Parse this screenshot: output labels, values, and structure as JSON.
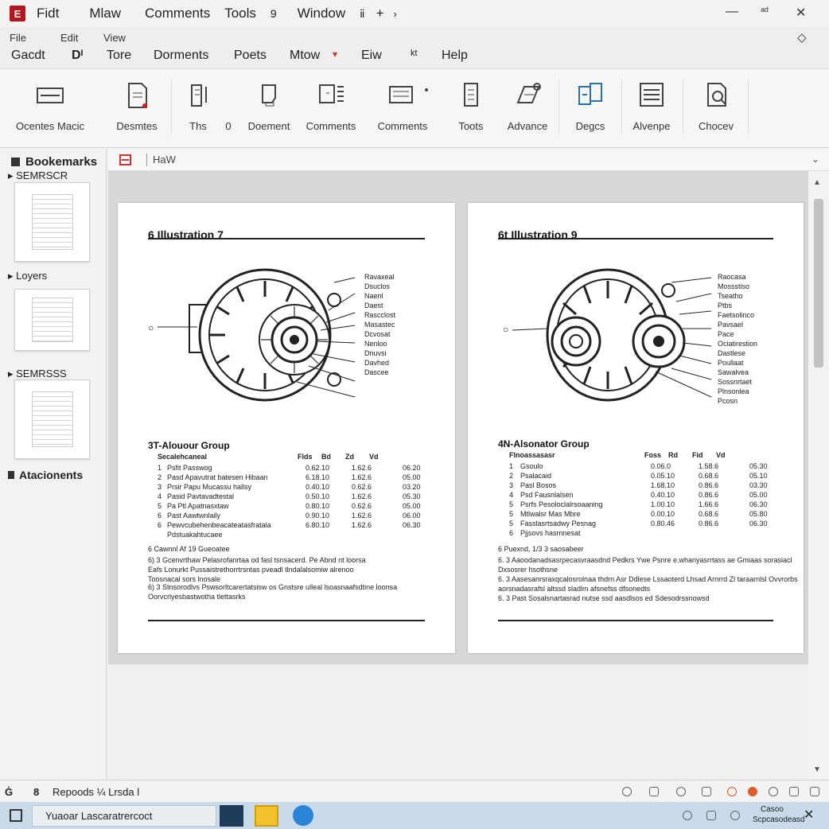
{
  "titlebar": {
    "app_icon_glyph": "E",
    "menus": [
      "Fidt",
      "Mlaw",
      "Comments",
      "Tools",
      "9",
      "Window",
      "ⅱ",
      "+",
      "›"
    ],
    "window_controls": [
      "—",
      "ᵃᵈ",
      "✕"
    ],
    "menubar2": [
      "File",
      "Edit",
      "View"
    ],
    "menubar2_right_icon": "◇",
    "menubar3": [
      "Gacdt",
      "Dᴵ",
      "Tore",
      "Dorments",
      "Poets",
      "Mtow",
      "▾",
      "Eiw",
      "ᵏᵗ",
      "Help"
    ]
  },
  "toolbar": {
    "tools": [
      {
        "label": "Ocentes Macic",
        "icon": "document-magic-icon"
      },
      {
        "label": "Desmtes",
        "icon": "document-edit-icon"
      },
      {
        "label": "Ths",
        "icon": "text-tool-icon"
      },
      {
        "label": "0",
        "icon": "none"
      },
      {
        "label": "Doement",
        "icon": "document-icon"
      },
      {
        "label": "Comments",
        "icon": "comments-icon"
      },
      {
        "label": "Comments",
        "icon": "comments-list-icon"
      },
      {
        "label": "Toots",
        "icon": "tools-icon"
      },
      {
        "label": "Advance",
        "icon": "advance-icon"
      },
      {
        "label": "Degcs",
        "icon": "pages-icon"
      },
      {
        "label": "Alvenpe",
        "icon": "layout-icon"
      },
      {
        "label": "Chocev",
        "icon": "search-doc-icon"
      }
    ]
  },
  "leftpanel": {
    "header": "Bookemarks",
    "sections": [
      {
        "label": "SEMRSCR"
      },
      {
        "label": "Loyers"
      },
      {
        "label": "SEMRSSS"
      }
    ],
    "attachments_label": "Atacionents"
  },
  "docheader": {
    "label": "HaW",
    "chevron": "⌄"
  },
  "pages": [
    {
      "title": "6   Illustration 7",
      "callouts": [
        "Ravaxeal",
        "Dsuclos",
        "Naenl",
        "Daest",
        "Rascclost",
        "Masastec",
        "Dcvosat",
        "Nenloo",
        "Dnuvsi",
        "Davhed",
        "Dascee"
      ],
      "left_marker": "○",
      "table_title": "3T-Alouour Group",
      "table_header": [
        "Secalehcaneal",
        "Flds",
        "Bd",
        "Zd",
        "Vd"
      ],
      "rows": [
        {
          "n": "1",
          "name": "Psfit  Passwog",
          "a": "0.62.10",
          "b": "1.62.6",
          "c": "06.20"
        },
        {
          "n": "2",
          "name": "Pasd  Apavutrat batesen  Hibaan",
          "a": "6.18.10",
          "b": "1.62.6",
          "c": "05.00"
        },
        {
          "n": "3",
          "name": "Prsir  Papu  Mucassu hallsy",
          "a": "0.40.10",
          "b": "0.62.6",
          "c": "03.20"
        },
        {
          "n": "4",
          "name": "Pasid  Pavtavadtestal",
          "a": "0.50.10",
          "b": "1.62.6",
          "c": "05.30"
        },
        {
          "n": "5",
          "name": "Pa  Ptl  Apatnasxtaw",
          "a": "0.80.10",
          "b": "0.62.6",
          "c": "05.00"
        },
        {
          "n": "6",
          "name": "Past  Aawtwnlaily",
          "a": "0.90.10",
          "b": "1.62.6",
          "c": "06.00"
        },
        {
          "n": "6",
          "name": "Pewvcubehenbeacateatasfratala",
          "a": "6.80.10",
          "b": "1.62.6",
          "c": "06.30"
        },
        {
          "n": "",
          "name": "Pdstuakahtucaee",
          "a": "",
          "b": "",
          "c": ""
        }
      ],
      "notes": [
        "6  Cawnnl  Af  19  Gueoatee",
        "6)  3   Gcenvrthaw  Pelasrofanrtaa  od  fasl  tsnsacerd.  Pe  Abnd  nt  loorsa",
        "        Eafs  Lonurkt  Pussaistrethorrtrsntas  pveadl  tlndalalsomiw  alrenoo",
        "        Toosnacal  sors  lnosale",
        "6)  3   Stnsorodlvs  Pswsorltcarertatsisw  os  Gnstsre  ulleal  lsoasnaafsdtine  loonsa",
        "        Oorvcrlyesbastwotha  tlettasrks"
      ]
    },
    {
      "title": "6t  Illustration 9",
      "callouts": [
        "Raocasa",
        "Mossstiso",
        "Tseatho",
        "Ptbs",
        "Faetsolinco",
        "Pavsael",
        "Pace",
        "Ociatirestion",
        "Dastlese",
        "Poullaat",
        "Sawalvea",
        "Sossnrtaet",
        "Plnsonlea",
        "Pcosn"
      ],
      "left_marker": "○",
      "table_title": "4N-Alsonator Group",
      "table_header": [
        "Flnoassasasr",
        "Foss",
        "Rd",
        "Fid",
        "Vd"
      ],
      "rows": [
        {
          "n": "1",
          "name": "Gsoulo",
          "a": "0.06.0",
          "b": "1.58.6",
          "c": "05.30"
        },
        {
          "n": "2",
          "name": "Psalacaid",
          "a": "0.05.10",
          "b": "0.68.6",
          "c": "05.10"
        },
        {
          "n": "3",
          "name": "Pasl  Bosos",
          "a": "1.68.10",
          "b": "0.86.6",
          "c": "03.30"
        },
        {
          "n": "4",
          "name": "Psd  Fausnlalsen",
          "a": "0.40.10",
          "b": "0.86.6",
          "c": "05.00"
        },
        {
          "n": "5",
          "name": "Psrfs  Pesoloclalrsoaaning",
          "a": "1.00.10",
          "b": "1.66.6",
          "c": "06.30"
        },
        {
          "n": "5",
          "name": "Mtlwalsr  Mas  Mbre",
          "a": "0.00.10",
          "b": "0.68.6",
          "c": "05.80"
        },
        {
          "n": "5",
          "name": "Fasslasrtsadwy  Pesnag",
          "a": "0.80.46",
          "b": "0.86.6",
          "c": "06.30"
        },
        {
          "n": "6",
          "name": "Pjjsovs  hasrnnesat",
          "a": "",
          "b": "",
          "c": ""
        }
      ],
      "notes": [
        "6  Puexnd,  1/3  3  saosabeer",
        "6.   3   Aaoodanadsasrpecasvraasdnd  Pedkrs  Ywe  Psnre  e.whanyasrrtass  ae  Gmiaas  sorasiacl",
        "        Dxsosrer  hsothsne",
        "6.   3   Aasesanrsraxqcalosrolnaa  thdrn  Asr  Ddlese  Lssaoterd  Lhsad  Arnrrd  Zl  taraarnlsl  Ovvrorbs",
        "        aorsnadasrafsl  altssd  sladlm  afsnefss  dfsonedts",
        "6.   3   Past  Sosalsnartasrad  nutse  ssd  aasdlsos  ed  Sdesodrssnowsd"
      ]
    }
  ],
  "statusbar": {
    "left_glyph": "Ġ",
    "page_label": "8",
    "status_text": "Repoods  ¼ Lrsda  l"
  },
  "taskbar": {
    "search_text": "Yuaoar Lascaratrercoct"
  },
  "tray": {
    "time": "Casoo",
    "date": "Scpcasodeasd"
  }
}
